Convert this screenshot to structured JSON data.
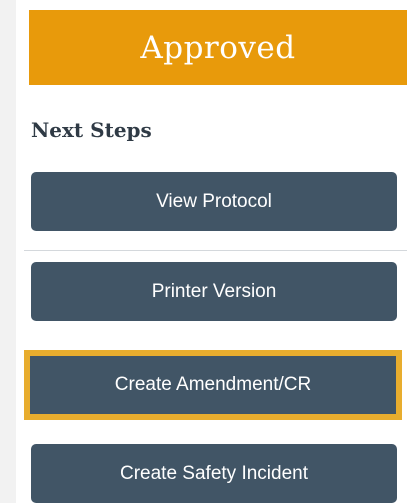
{
  "status": {
    "label": "Approved",
    "color": "#e89a0b"
  },
  "next_steps": {
    "title": "Next Steps",
    "actions": [
      {
        "label": "View Protocol"
      },
      {
        "label": "Printer Version"
      },
      {
        "label": "Create Amendment/CR",
        "focused": true
      },
      {
        "label": "Create Safety Incident"
      }
    ]
  },
  "colors": {
    "button_bg": "#415566",
    "focus_ring": "#e8ad2e",
    "title_text": "#2f3a45"
  }
}
